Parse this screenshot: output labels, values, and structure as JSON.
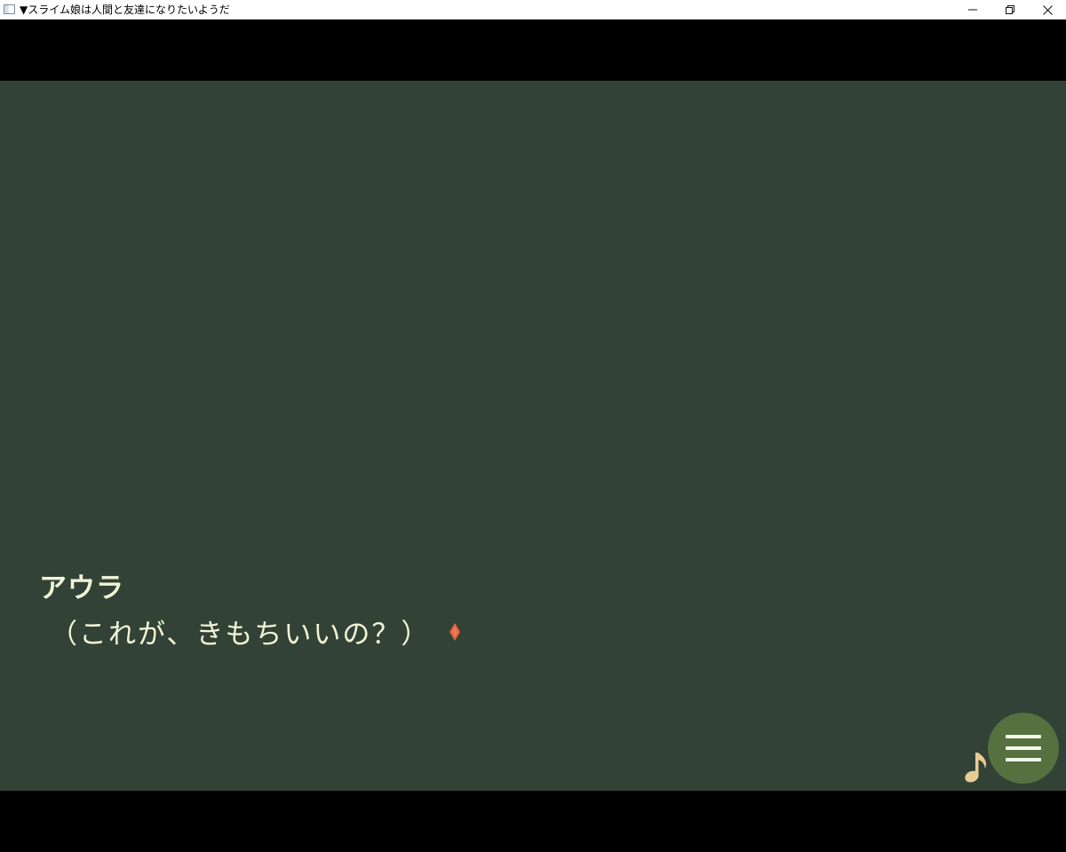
{
  "window": {
    "title": "▼スライム娘は人間と友達になりたいようだ"
  },
  "dialogue": {
    "speaker": "アウラ",
    "text": "（これが、きもちいいの？）"
  },
  "icons": {
    "advance": "diamond-icon",
    "music": "music-note-icon",
    "menu": "hamburger-menu-icon"
  },
  "colors": {
    "background": "#334236",
    "text": "#f1f5d6",
    "indicator": "#e8603c",
    "menu_button": "#56703f",
    "music_note": "#e8cc96"
  }
}
